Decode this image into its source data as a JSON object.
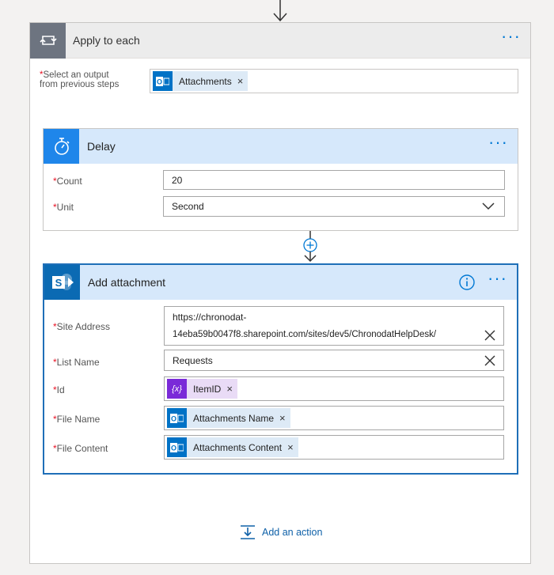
{
  "apply_to_each": {
    "title": "Apply to each",
    "select_label_line1": "Select an output",
    "select_label_line2": "from previous steps",
    "token": "Attachments"
  },
  "delay": {
    "title": "Delay",
    "count_label": "Count",
    "count_value": "20",
    "unit_label": "Unit",
    "unit_value": "Second"
  },
  "add_attachment": {
    "title": "Add attachment",
    "site_address_label": "Site Address",
    "site_address_line1": "https://chronodat-",
    "site_address_line2": "14eba59b0047f8.sharepoint.com/sites/dev5/ChronodatHelpDesk/",
    "list_name_label": "List Name",
    "list_name_value": "Requests",
    "id_label": "Id",
    "id_token": "ItemID",
    "file_name_label": "File Name",
    "file_name_token": "Attachments Name",
    "file_content_label": "File Content",
    "file_content_token": "Attachments Content"
  },
  "add_action_label": "Add an action",
  "colors": {
    "accent": "#0078d4",
    "delay_icon_bg": "#1f86ea",
    "sharepoint_bg": "#0b6ab3",
    "outlook_bg": "#0072c6",
    "variable_bg": "#7a2ad8",
    "required": "#e81123"
  },
  "icons": {
    "loop": "loop-icon",
    "timer": "timer-icon",
    "sharepoint": "sharepoint-icon",
    "outlook": "outlook-icon",
    "variable": "variable-icon",
    "info": "info-icon",
    "more": "more-icon",
    "add_action": "add-action-icon"
  }
}
